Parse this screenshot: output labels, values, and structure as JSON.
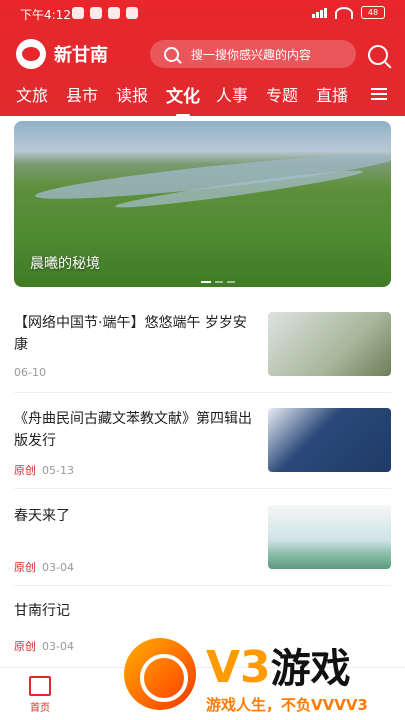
{
  "status": {
    "time": "下午4:12",
    "battery": "48"
  },
  "app": {
    "name": "新甘南",
    "search_placeholder": "搜一搜你感兴趣的内容"
  },
  "tabs": [
    "文旅",
    "县市",
    "读报",
    "文化",
    "人事",
    "专题",
    "直播"
  ],
  "active_tab": "文化",
  "banner": {
    "caption": "晨曦的秘境"
  },
  "articles": [
    {
      "title": "【网络中国节·端午】悠悠端午 岁岁安康",
      "tag": "",
      "date": "06-10"
    },
    {
      "title": "《舟曲民间古藏文苯教文献》第四辑出版发行",
      "tag": "原创",
      "date": "05-13"
    },
    {
      "title": "春天来了",
      "tag": "原创",
      "date": "03-04"
    },
    {
      "title": "甘南行记",
      "tag": "原创",
      "date": "03-04"
    }
  ],
  "bottom_nav": {
    "home_label": "首页"
  },
  "watermark": {
    "brand": "V3",
    "brand_cn": "游戏",
    "slogan": "游戏人生，不负VVVV3"
  },
  "colors": {
    "brand_red": "#e8262b",
    "accent_orange": "#ff9a00"
  }
}
